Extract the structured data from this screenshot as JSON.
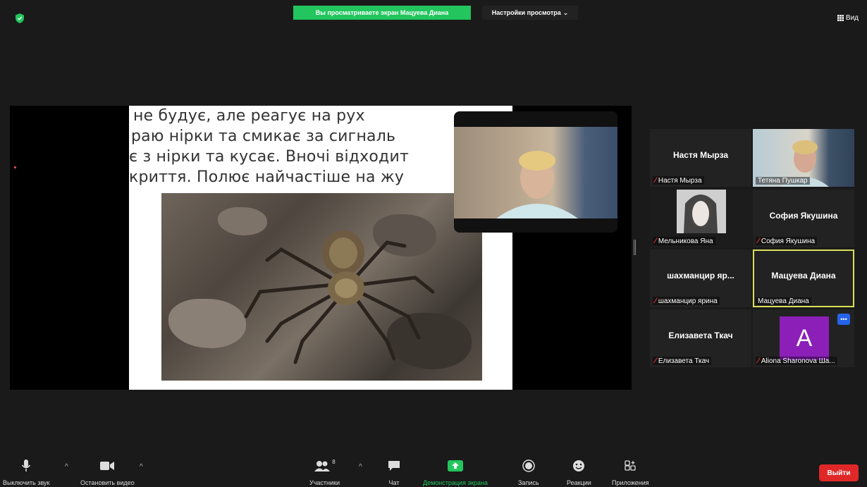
{
  "top": {
    "share_banner": "Вы просматриваете экран Мацуева Диана",
    "view_settings": "Настройки просмотра",
    "view_button": "Вид"
  },
  "slide": {
    "lines": [
      "не будує, але реагує на рух",
      "раю нірки та смикає за сигналь",
      "є з нірки та кусає. Вночі відходит",
      "криття. Полює найчастіше на жу"
    ]
  },
  "participants": [
    {
      "big_name": "Настя Мырза",
      "label": "Настя Мырза",
      "muted": true,
      "video": false
    },
    {
      "big_name": "",
      "label": "Тетяна Пушкар",
      "muted": false,
      "video": true
    },
    {
      "big_name": "",
      "label": "Мельникова Яна",
      "muted": true,
      "video": true
    },
    {
      "big_name": "София Якушина",
      "label": "София Якушина",
      "muted": true,
      "video": false
    },
    {
      "big_name": "шахманцир яр...",
      "label": "шахманцир ярина",
      "muted": true,
      "video": false
    },
    {
      "big_name": "Мацуева Диана",
      "label": "Мацуева Диана",
      "muted": false,
      "video": false,
      "active": true
    },
    {
      "big_name": "Елизавета Ткач",
      "label": "Елизавета Ткач",
      "muted": true,
      "video": false
    },
    {
      "big_name": "",
      "label": "Aliona Sharonova Ша...",
      "muted": true,
      "video": false,
      "avatar": "A"
    }
  ],
  "toolbar": {
    "mute": "Выключить звук",
    "stop_video": "Остановить видео",
    "participants": "Участники",
    "participants_count": "8",
    "chat": "Чат",
    "share": "Демонстрация экрана",
    "record": "Запись",
    "reactions": "Реакции",
    "apps": "Приложения",
    "leave": "Выйти"
  },
  "colors": {
    "share_green": "#22c55e",
    "leave_red": "#e02828",
    "active_speaker": "#d9e05a",
    "avatar_purple": "#8b1fb8"
  }
}
